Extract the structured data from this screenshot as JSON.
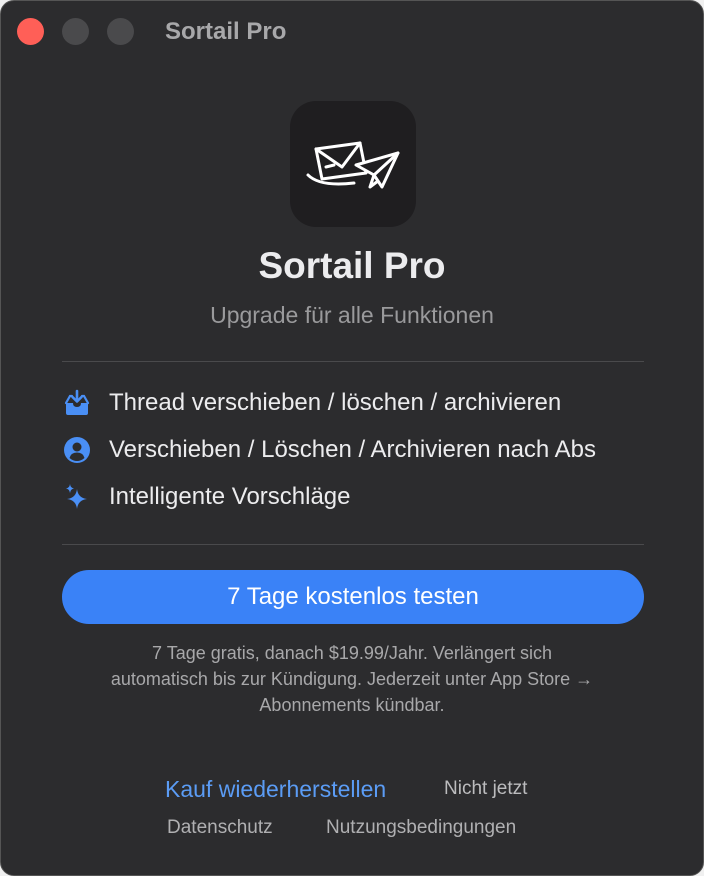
{
  "window": {
    "title": "Sortail Pro"
  },
  "header": {
    "app_icon": "envelope-paperplane-icon",
    "app_name": "Sortail Pro",
    "subtitle": "Upgrade für alle Funktionen"
  },
  "features": [
    {
      "icon": "tray-download-icon",
      "label": "Thread verschieben / löschen / archivieren"
    },
    {
      "icon": "person-circle-icon",
      "label": "Verschieben / Löschen / Archivieren nach Abs"
    },
    {
      "icon": "sparkles-icon",
      "label": "Intelligente Vorschläge"
    }
  ],
  "cta": {
    "label": "7 Tage kostenlos testen"
  },
  "fineprint": {
    "line1": "7 Tage gratis, danach $19.99/Jahr. Verlängert sich",
    "line2": "automatisch bis zur Kündigung. Jederzeit unter App Store →",
    "line3": "Abonnements kündbar."
  },
  "footer": {
    "restore_label": "Kauf wiederherstellen",
    "not_now_label": "Nicht jetzt",
    "privacy_label": "Datenschutz",
    "terms_label": "Nutzungsbedingungen"
  },
  "colors": {
    "window_bg": "#2c2c2e",
    "accent": "#3a82f7",
    "link": "#5b9cf5",
    "close_button": "#ff5f57"
  }
}
